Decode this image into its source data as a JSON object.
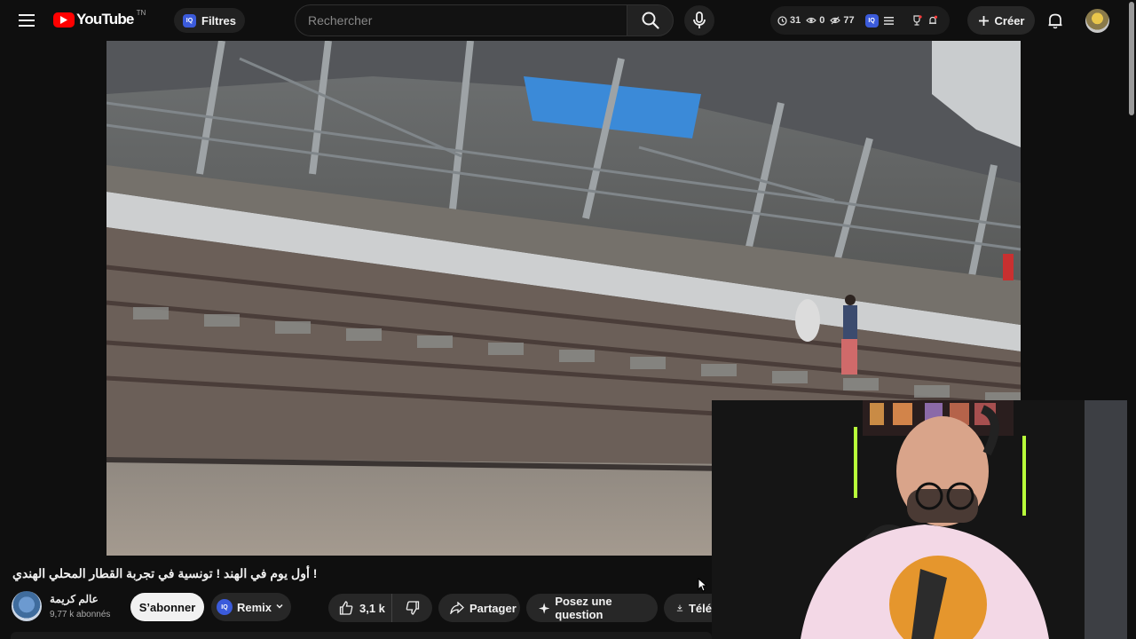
{
  "header": {
    "logo_text": "YouTube",
    "logo_country": "TN",
    "filters_label": "Filtres",
    "iq_badge": "IQ",
    "search_placeholder": "Rechercher",
    "stats": {
      "watch_count": "31",
      "eye_count": "0",
      "views_count": "77"
    },
    "create_label": "Créer"
  },
  "video": {
    "title": "أول يوم في الهند ! تونسية في تجربة القطار المحلي الهندي !"
  },
  "channel": {
    "name": "عالم كريمة",
    "subscribers": "9,77 k abonnés",
    "subscribe_label": "S’abonner",
    "remix_label": "Remix"
  },
  "actions": {
    "like_count": "3,1 k",
    "share_label": "Partager",
    "ask_label": "Posez une question",
    "download_label": "Télé"
  },
  "colors": {
    "background": "#0f0f0f",
    "brand_red": "#ff0000",
    "iq_blue": "#3b5bdb",
    "pill_bg": "#272727"
  }
}
